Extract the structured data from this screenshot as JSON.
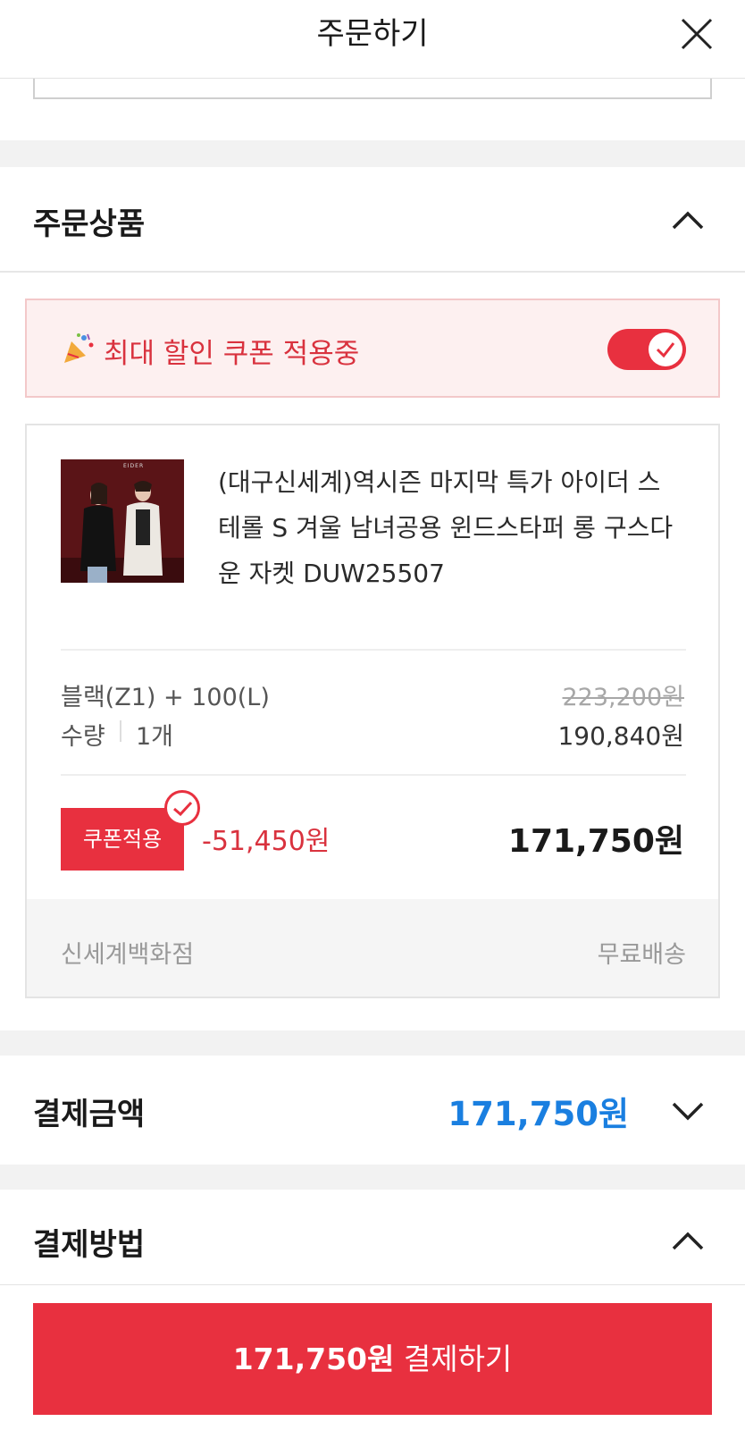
{
  "header": {
    "title": "주문하기",
    "close_icon": "close-icon"
  },
  "order_items": {
    "label": "주문상품",
    "coupon_banner": {
      "text": "최대 할인 쿠폰 적용중",
      "icon": "party-popper-icon",
      "toggle_on": true
    },
    "product": {
      "name": "(대구신세계)역시즌 마지막 특가 아이더 스테롤 S 겨울 남녀공용 윈드스타퍼 롱 구스다운 자켓 DUW25507",
      "thumb_text": "EIDER",
      "option": "블랙(Z1) + 100(L)",
      "qty_label": "수량",
      "qty_value": "1개",
      "original_price": "223,200원",
      "sale_price": "190,840원",
      "coupon_label": "쿠폰적용",
      "discount": "-51,450원",
      "final_price": "171,750원",
      "seller": "신세계백화점",
      "shipping": "무료배송"
    }
  },
  "payment_amount": {
    "label": "결제금액",
    "total": "171,750원"
  },
  "payment_method": {
    "label": "결제방법"
  },
  "pay_button": {
    "amount": "171,750원",
    "label": " 결제하기"
  },
  "colors": {
    "accent_red": "#e8303f",
    "total_blue": "#1a7fe0"
  }
}
